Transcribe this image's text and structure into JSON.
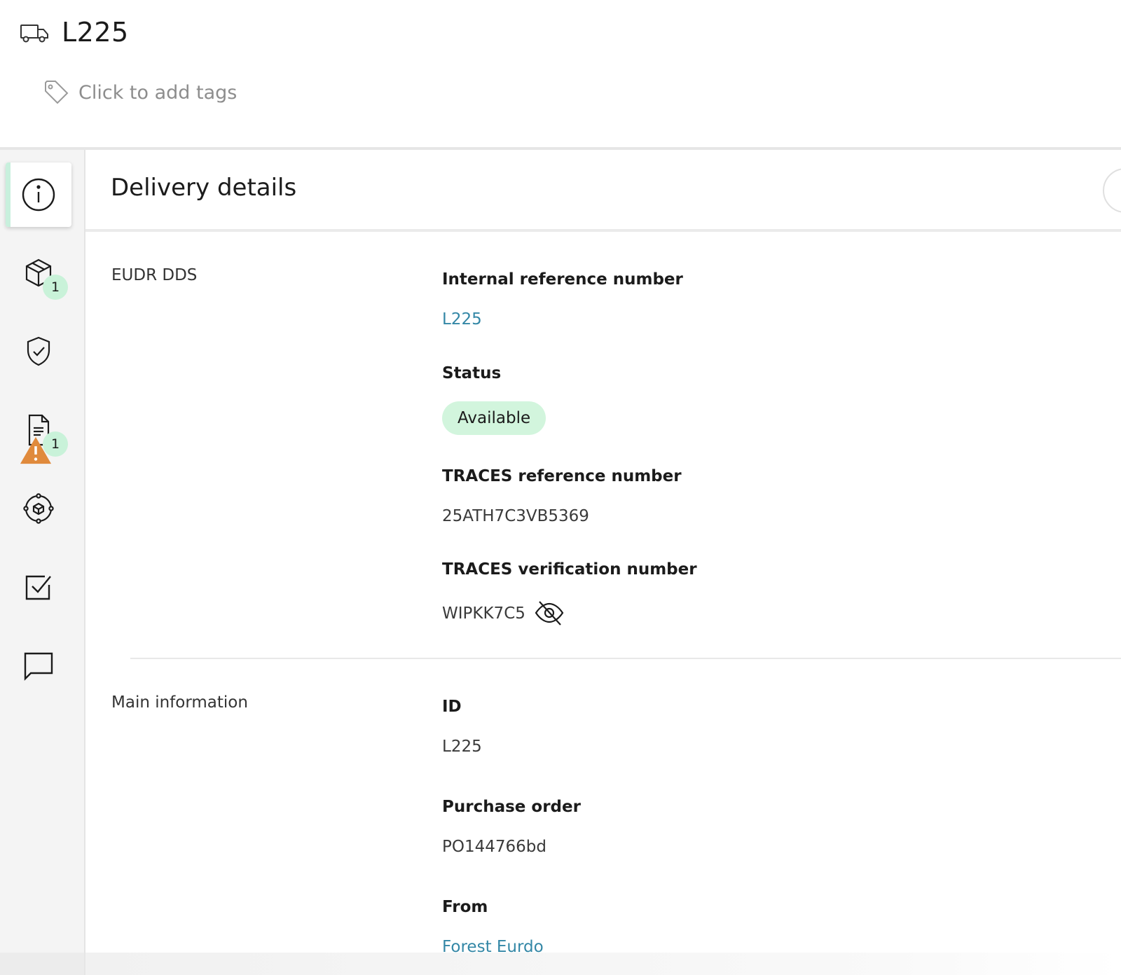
{
  "header": {
    "title": "L225",
    "tags_placeholder": "Click to add tags"
  },
  "sidebar": {
    "items": [
      {
        "name": "details",
        "icon": "info-icon",
        "active": true
      },
      {
        "name": "products",
        "icon": "box-icon",
        "badge": "1"
      },
      {
        "name": "compliance",
        "icon": "shield-check-icon"
      },
      {
        "name": "documents",
        "icon": "document-icon",
        "badge": "1",
        "warning": true
      },
      {
        "name": "locations",
        "icon": "target-icon"
      },
      {
        "name": "tasks",
        "icon": "checkbox-icon"
      },
      {
        "name": "comments",
        "icon": "comment-icon"
      }
    ]
  },
  "panel": {
    "title": "Delivery details"
  },
  "eudr": {
    "section_label": "EUDR DDS",
    "internal_ref_label": "Internal reference number",
    "internal_ref_value": "L225",
    "status_label": "Status",
    "status_value": "Available",
    "traces_ref_label": "TRACES reference number",
    "traces_ref_value": "25ATH7C3VB5369",
    "traces_ver_label": "TRACES verification number",
    "traces_ver_value": "WIPKK7C5"
  },
  "main_info": {
    "section_label": "Main information",
    "id_label": "ID",
    "id_value": "L225",
    "po_label": "Purchase order",
    "po_value": "PO144766bd",
    "from_label": "From",
    "from_value": "Forest Eurdo"
  },
  "colors": {
    "link": "#3387a6",
    "status_bg": "#d2f5dd",
    "badge_bg": "#c9f2d9",
    "warning": "#e08a3c",
    "sidebar_bg": "#f4f4f4"
  }
}
